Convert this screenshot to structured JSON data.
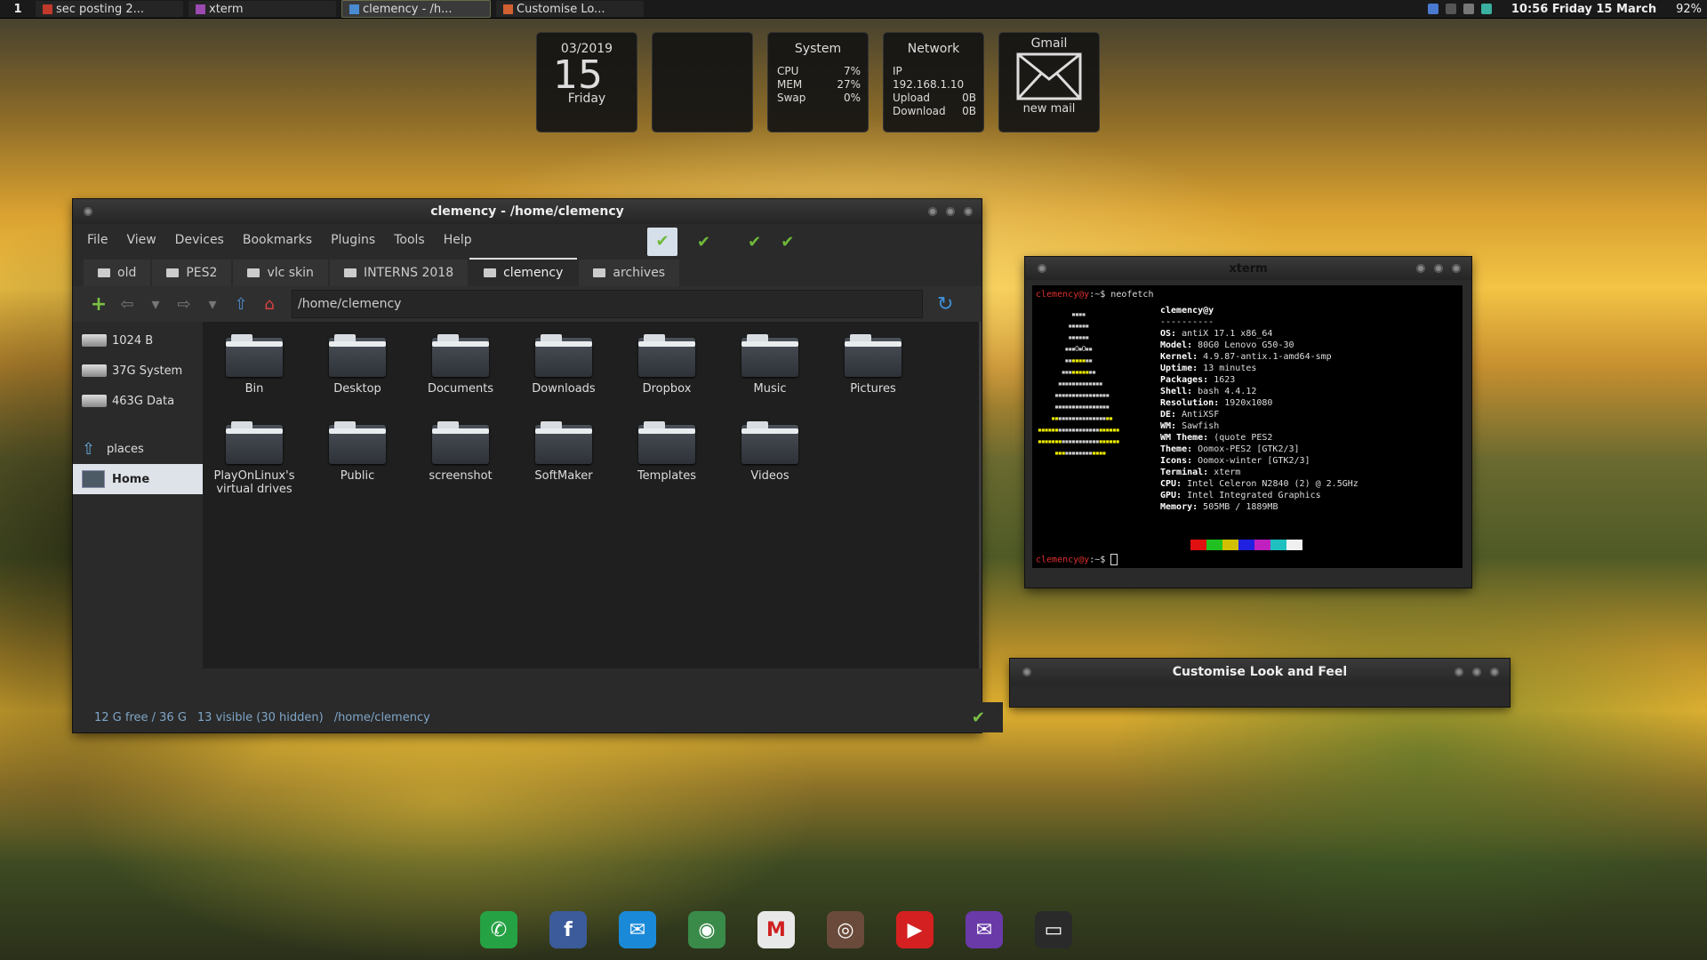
{
  "top_panel": {
    "workspace": "1",
    "tasks": [
      {
        "label": "sec posting 2...",
        "icon": "document-icon",
        "color": "#c0392b"
      },
      {
        "label": "xterm",
        "icon": "terminal-icon",
        "color": "#9a4ab0"
      },
      {
        "label": "clemency - /h...",
        "icon": "folder-icon",
        "color": "#4a8ad0"
      },
      {
        "label": "Customise Lo...",
        "icon": "settings-icon",
        "color": "#d06030"
      }
    ],
    "clock": "10:56  Friday 15 March",
    "battery": "92%"
  },
  "widgets": {
    "date": {
      "month_year": "03/2019",
      "day": "15",
      "weekday": "Friday"
    },
    "system": {
      "title": "System",
      "rows": [
        {
          "k": "CPU",
          "v": "7%"
        },
        {
          "k": "MEM",
          "v": "27%"
        },
        {
          "k": "Swap",
          "v": "0%"
        }
      ]
    },
    "network": {
      "title": "Network",
      "rows": [
        {
          "k": "IP 192.168.1.10",
          "v": ""
        },
        {
          "k": "Upload",
          "v": "0B"
        },
        {
          "k": "Download",
          "v": "0B"
        }
      ]
    },
    "gmail": {
      "title": "Gmail",
      "sub": "new mail"
    }
  },
  "file_manager": {
    "title": "clemency - /home/clemency",
    "menu": [
      "File",
      "View",
      "Devices",
      "Bookmarks",
      "Plugins",
      "Tools",
      "Help"
    ],
    "tabs": [
      "old",
      "PES2",
      "vlc skin",
      "INTERNS 2018",
      "clemency",
      "archives"
    ],
    "active_tab": "clemency",
    "path": "/home/clemency",
    "drives": [
      "1024 B",
      "37G System",
      "463G Data"
    ],
    "side": {
      "places": "places",
      "home": "Home"
    },
    "folders": [
      "Bin",
      "Desktop",
      "Documents",
      "Downloads",
      "Dropbox",
      "Music",
      "Pictures",
      "PlayOnLinux's virtual drives",
      "Public",
      "screenshot",
      "SoftMaker",
      "Templates",
      "Videos"
    ],
    "status": {
      "free": "12 G free / 36 G",
      "visible": "13 visible (30 hidden)",
      "path": "/home/clemency"
    }
  },
  "xterm": {
    "title": "xterm",
    "prompt": "clemency@y",
    "command": ":~$ neofetch",
    "prompt_end": ":~$ ",
    "user_host": "clemency@y",
    "separator": "----------",
    "info": [
      {
        "k": "OS:",
        "v": " antiX 17.1 x86_64"
      },
      {
        "k": "Model:",
        "v": " 80G0 Lenovo G50-30"
      },
      {
        "k": "Kernel:",
        "v": " 4.9.87-antix.1-amd64-smp"
      },
      {
        "k": "Uptime:",
        "v": " 13 minutes"
      },
      {
        "k": "Packages:",
        "v": " 1623"
      },
      {
        "k": "Shell:",
        "v": " bash 4.4.12"
      },
      {
        "k": "Resolution:",
        "v": " 1920x1080"
      },
      {
        "k": "DE:",
        "v": " AntiXSF"
      },
      {
        "k": "WM:",
        "v": " Sawfish"
      },
      {
        "k": "WM Theme:",
        "v": " (quote PES2"
      },
      {
        "k": "Theme:",
        "v": " Oomox-PES2 [GTK2/3]"
      },
      {
        "k": "Icons:",
        "v": " Oomox-winter [GTK2/3]"
      },
      {
        "k": "Terminal:",
        "v": " xterm"
      },
      {
        "k": "CPU:",
        "v": " Intel Celeron N2840 (2) @ 2.5GHz"
      },
      {
        "k": "GPU:",
        "v": " Intel Integrated Graphics"
      },
      {
        "k": "Memory:",
        "v": " 505MB / 1889MB"
      }
    ],
    "palette": [
      "#000000",
      "#e01010",
      "#20c020",
      "#d0c000",
      "#2020e0",
      "#c020c0",
      "#20c0c0",
      "#f0f0f0"
    ]
  },
  "customise": {
    "title": "Customise Look and Feel"
  },
  "dock": [
    {
      "name": "whatsapp-icon",
      "color": "#25a244",
      "glyph": "✆"
    },
    {
      "name": "facebook-icon",
      "color": "#3b5b9a",
      "glyph": "f"
    },
    {
      "name": "mail-icon",
      "color": "#1a8ad8",
      "glyph": "✉"
    },
    {
      "name": "browser-icon",
      "color": "#3a8a4a",
      "glyph": "◉"
    },
    {
      "name": "gmail-icon",
      "color": "#e8e8e8",
      "glyph": "M"
    },
    {
      "name": "instagram-icon",
      "color": "#6a4a3a",
      "glyph": "◎"
    },
    {
      "name": "youtube-icon",
      "color": "#d42020",
      "glyph": "▶"
    },
    {
      "name": "yahoo-mail-icon",
      "color": "#6a3aa8",
      "glyph": "✉"
    },
    {
      "name": "terminal-icon",
      "color": "#2a2a2a",
      "glyph": "▭"
    }
  ]
}
